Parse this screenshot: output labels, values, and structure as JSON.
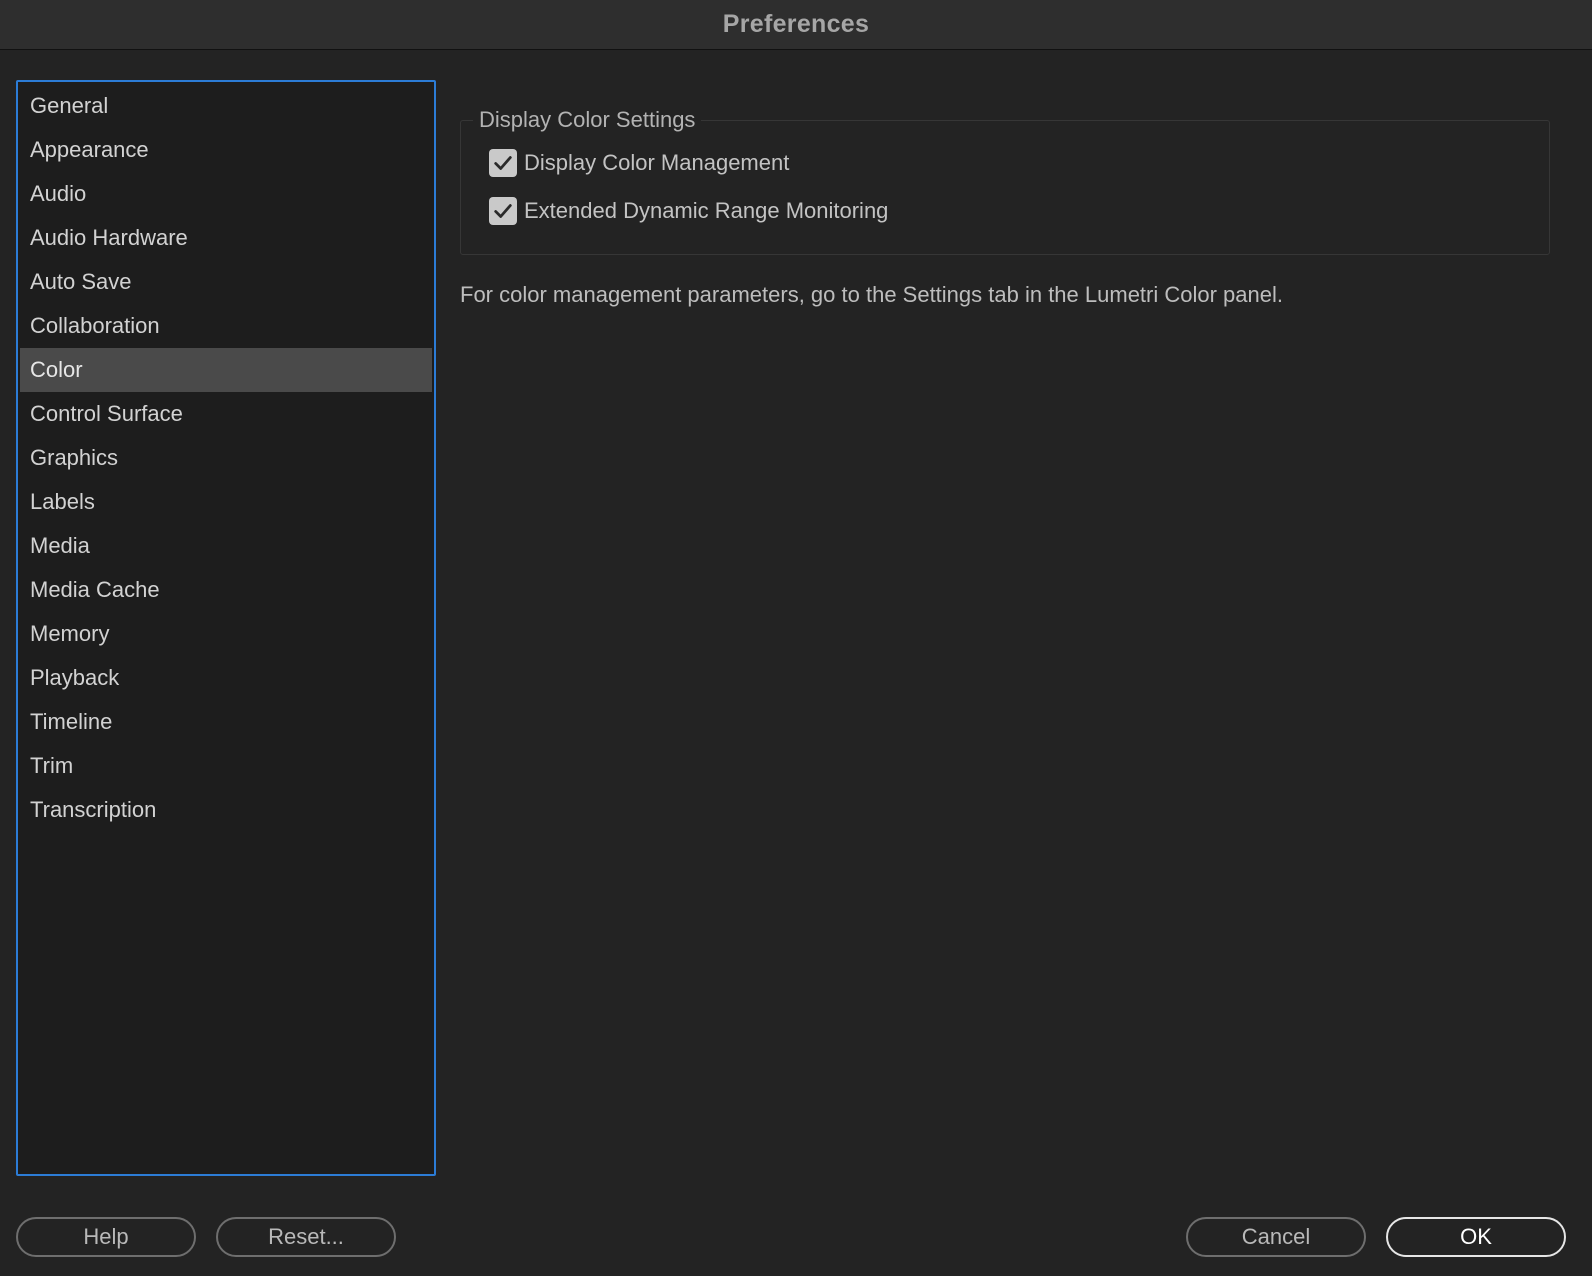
{
  "window": {
    "title": "Preferences"
  },
  "sidebar": {
    "items": [
      {
        "label": "General",
        "selected": false
      },
      {
        "label": "Appearance",
        "selected": false
      },
      {
        "label": "Audio",
        "selected": false
      },
      {
        "label": "Audio Hardware",
        "selected": false
      },
      {
        "label": "Auto Save",
        "selected": false
      },
      {
        "label": "Collaboration",
        "selected": false
      },
      {
        "label": "Color",
        "selected": true
      },
      {
        "label": "Control Surface",
        "selected": false
      },
      {
        "label": "Graphics",
        "selected": false
      },
      {
        "label": "Labels",
        "selected": false
      },
      {
        "label": "Media",
        "selected": false
      },
      {
        "label": "Media Cache",
        "selected": false
      },
      {
        "label": "Memory",
        "selected": false
      },
      {
        "label": "Playback",
        "selected": false
      },
      {
        "label": "Timeline",
        "selected": false
      },
      {
        "label": "Trim",
        "selected": false
      },
      {
        "label": "Transcription",
        "selected": false
      }
    ]
  },
  "main": {
    "group_title": "Display Color Settings",
    "checkboxes": [
      {
        "label": "Display Color Management",
        "checked": true,
        "icon": "checkmark-icon"
      },
      {
        "label": "Extended Dynamic Range Monitoring",
        "checked": true,
        "icon": "checkmark-icon"
      }
    ],
    "hint": "For color management parameters, go to the Settings tab in the Lumetri Color panel."
  },
  "footer": {
    "help_label": "Help",
    "reset_label": "Reset...",
    "cancel_label": "Cancel",
    "ok_label": "OK"
  },
  "colors": {
    "accent": "#2c7cd6",
    "background": "#232323",
    "selected_item": "#4a4a4a"
  }
}
